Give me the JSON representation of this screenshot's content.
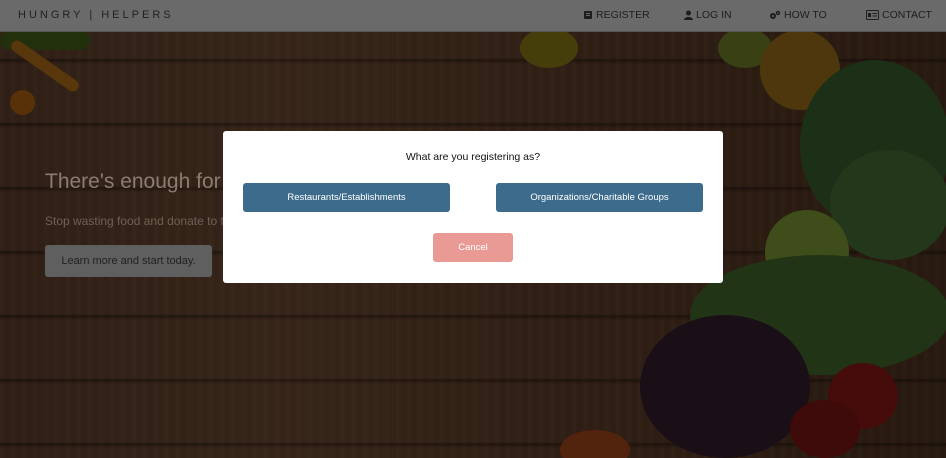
{
  "navbar": {
    "brand": "HUNGRY  |  HELPERS",
    "items": [
      {
        "label": "REGISTER",
        "icon": "register-icon"
      },
      {
        "label": "LOG IN",
        "icon": "user-icon"
      },
      {
        "label": "HOW TO",
        "icon": "gears-icon"
      },
      {
        "label": "CONTACT",
        "icon": "contact-card-icon"
      }
    ]
  },
  "hero": {
    "title": "There's enough for",
    "subtitle": "Stop wasting food and donate to th",
    "button_label": "Learn more and start today."
  },
  "modal": {
    "title": "What are you registering as?",
    "restaurants_label": "Restaurants/Establishments",
    "organizations_label": "Organizations/Charitable Groups",
    "cancel_label": "Cancel"
  },
  "colors": {
    "primary_button": "#3c6b8c",
    "cancel_button": "#ea9a95",
    "navbar": "#6a6a6a"
  }
}
